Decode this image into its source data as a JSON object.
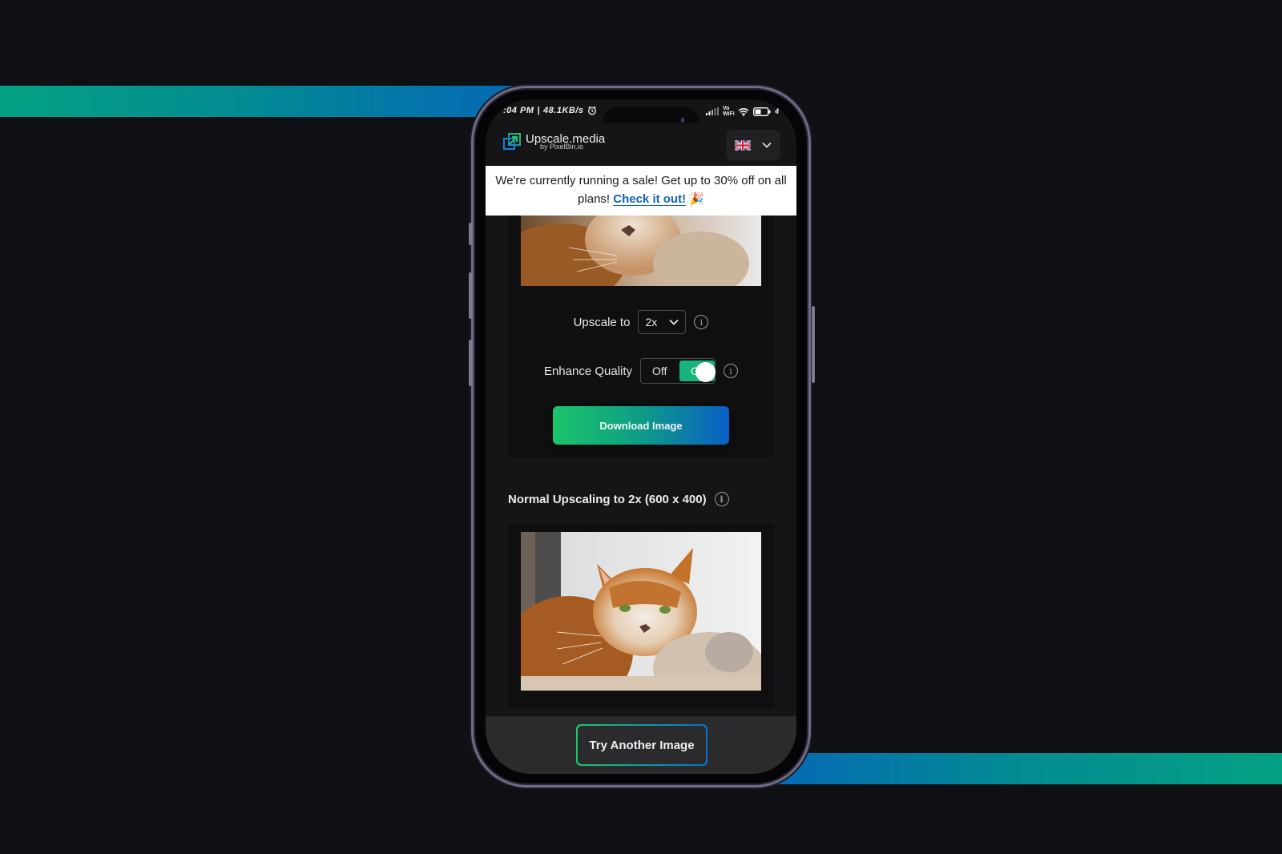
{
  "colors": {
    "stripe_green": "#04a184",
    "stripe_blue": "#0469b5",
    "accent_green": "#1cc56a",
    "accent_blue": "#0a5fc6",
    "link_blue": "#1463b5",
    "toggle_on": "#16b37a"
  },
  "statusbar": {
    "time": ":04 PM",
    "separator": "|",
    "net_speed": "48.1KB/s",
    "alarm_icon": "alarm-clock-icon",
    "signal_icon": "signal-bars-icon",
    "vowifi": "Vo WiFi",
    "wifi_icon": "wifi-icon",
    "battery_icon": "battery-icon",
    "battery_text": "4"
  },
  "header": {
    "logo_icon": "upscale-arrow-icon",
    "brand": "Upscale.media",
    "byline": "by PixelBin.io",
    "language_flag": "uk-flag-icon",
    "language_chevron": "chevron-down-icon"
  },
  "banner": {
    "text": "We're currently running a sale! Get up to 30% off on all plans!",
    "link_label": "Check it out!",
    "emoji": "🎉"
  },
  "controls": {
    "upscale_label": "Upscale to",
    "upscale_value": "2x",
    "enhance_label": "Enhance Quality",
    "toggle_off": "Off",
    "toggle_on": "On",
    "enhance_enabled": true,
    "download_label": "Download Image"
  },
  "result": {
    "title": "Normal Upscaling to 2x (600 x 400)",
    "image_alt": "Orange and white cat lying on a fluffy cat bed by a window"
  },
  "footer": {
    "try_label": "Try Another Image"
  }
}
